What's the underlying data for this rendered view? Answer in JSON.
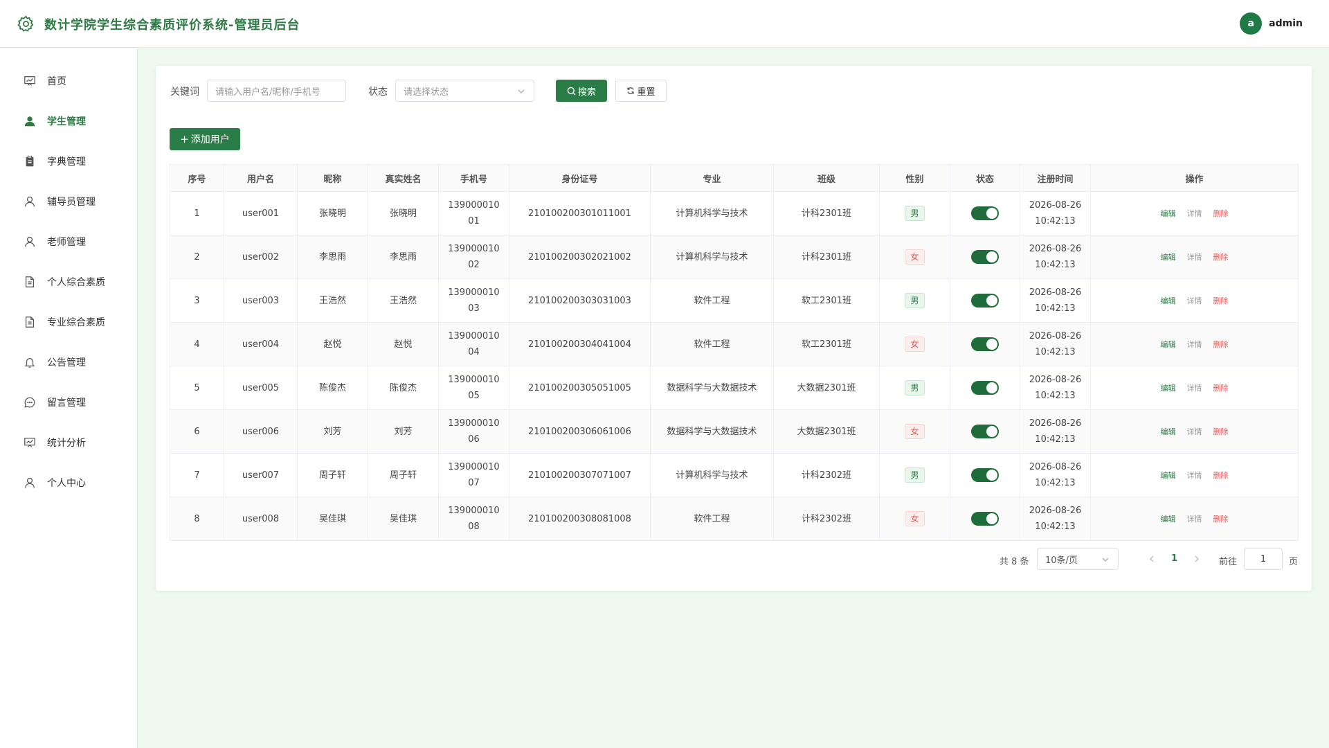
{
  "header": {
    "title": "数计学院学生综合素质评价系统-管理员后台",
    "avatar_letter": "a",
    "user_name": "admin",
    "logo_icon": "gear-icon"
  },
  "sidebar": {
    "items": [
      {
        "label": "首页",
        "icon": "chart-board-icon",
        "active": false
      },
      {
        "label": "学生管理",
        "icon": "user-solid-icon",
        "active": true
      },
      {
        "label": "字典管理",
        "icon": "clipboard-icon",
        "active": false
      },
      {
        "label": "辅导员管理",
        "icon": "user-icon",
        "active": false
      },
      {
        "label": "老师管理",
        "icon": "user-icon",
        "active": false
      },
      {
        "label": "个人综合素质",
        "icon": "document-icon",
        "active": false
      },
      {
        "label": "专业综合素质",
        "icon": "document-icon",
        "active": false
      },
      {
        "label": "公告管理",
        "icon": "bell-icon",
        "active": false
      },
      {
        "label": "留言管理",
        "icon": "chat-icon",
        "active": false
      },
      {
        "label": "统计分析",
        "icon": "chart-board-icon",
        "active": false
      },
      {
        "label": "个人中心",
        "icon": "user-icon",
        "active": false
      }
    ]
  },
  "filters": {
    "keyword_label": "关键词",
    "keyword_placeholder": "请输入用户名/昵称/手机号",
    "status_label": "状态",
    "status_placeholder": "请选择状态",
    "search_label": "搜索",
    "reset_label": "重置"
  },
  "toolbar": {
    "add_label": "添加用户"
  },
  "table": {
    "columns": [
      "序号",
      "用户名",
      "昵称",
      "真实姓名",
      "手机号",
      "身份证号",
      "专业",
      "班级",
      "性别",
      "状态",
      "注册时间",
      "操作"
    ],
    "rows": [
      {
        "no": "1",
        "username": "user001",
        "nickname": "张晓明",
        "realname": "张晓明",
        "phone_a": "139000010",
        "phone_b": "01",
        "id_card": "210100200301011001",
        "major": "计算机科学与技术",
        "class": "计科2301班",
        "gender": "男",
        "status_on": true,
        "date": "2026-08-26",
        "time": "10:42:13"
      },
      {
        "no": "2",
        "username": "user002",
        "nickname": "李思雨",
        "realname": "李思雨",
        "phone_a": "139000010",
        "phone_b": "02",
        "id_card": "210100200302021002",
        "major": "计算机科学与技术",
        "class": "计科2301班",
        "gender": "女",
        "status_on": true,
        "date": "2026-08-26",
        "time": "10:42:13"
      },
      {
        "no": "3",
        "username": "user003",
        "nickname": "王浩然",
        "realname": "王浩然",
        "phone_a": "139000010",
        "phone_b": "03",
        "id_card": "210100200303031003",
        "major": "软件工程",
        "class": "软工2301班",
        "gender": "男",
        "status_on": true,
        "date": "2026-08-26",
        "time": "10:42:13"
      },
      {
        "no": "4",
        "username": "user004",
        "nickname": "赵悦",
        "realname": "赵悦",
        "phone_a": "139000010",
        "phone_b": "04",
        "id_card": "210100200304041004",
        "major": "软件工程",
        "class": "软工2301班",
        "gender": "女",
        "status_on": true,
        "date": "2026-08-26",
        "time": "10:42:13"
      },
      {
        "no": "5",
        "username": "user005",
        "nickname": "陈俊杰",
        "realname": "陈俊杰",
        "phone_a": "139000010",
        "phone_b": "05",
        "id_card": "210100200305051005",
        "major": "数据科学与大数据技术",
        "class": "大数据2301班",
        "gender": "男",
        "status_on": true,
        "date": "2026-08-26",
        "time": "10:42:13"
      },
      {
        "no": "6",
        "username": "user006",
        "nickname": "刘芳",
        "realname": "刘芳",
        "phone_a": "139000010",
        "phone_b": "06",
        "id_card": "210100200306061006",
        "major": "数据科学与大数据技术",
        "class": "大数据2301班",
        "gender": "女",
        "status_on": true,
        "date": "2026-08-26",
        "time": "10:42:13"
      },
      {
        "no": "7",
        "username": "user007",
        "nickname": "周子轩",
        "realname": "周子轩",
        "phone_a": "139000010",
        "phone_b": "07",
        "id_card": "210100200307071007",
        "major": "计算机科学与技术",
        "class": "计科2302班",
        "gender": "男",
        "status_on": true,
        "date": "2026-08-26",
        "time": "10:42:13"
      },
      {
        "no": "8",
        "username": "user008",
        "nickname": "吴佳琪",
        "realname": "吴佳琪",
        "phone_a": "139000010",
        "phone_b": "08",
        "id_card": "210100200308081008",
        "major": "软件工程",
        "class": "计科2302班",
        "gender": "女",
        "status_on": true,
        "date": "2026-08-26",
        "time": "10:42:13"
      }
    ],
    "actions": {
      "edit": "编辑",
      "detail": "详情",
      "delete": "删除"
    }
  },
  "pagination": {
    "total_text": "共 8 条",
    "page_size": "10条/页",
    "current_page": "1",
    "goto_label": "前往",
    "goto_value": "1",
    "page_suffix": "页"
  },
  "colors": {
    "accent": "#2a7d46",
    "background": "#eef9ef",
    "female_tag": "#e05a5a"
  }
}
